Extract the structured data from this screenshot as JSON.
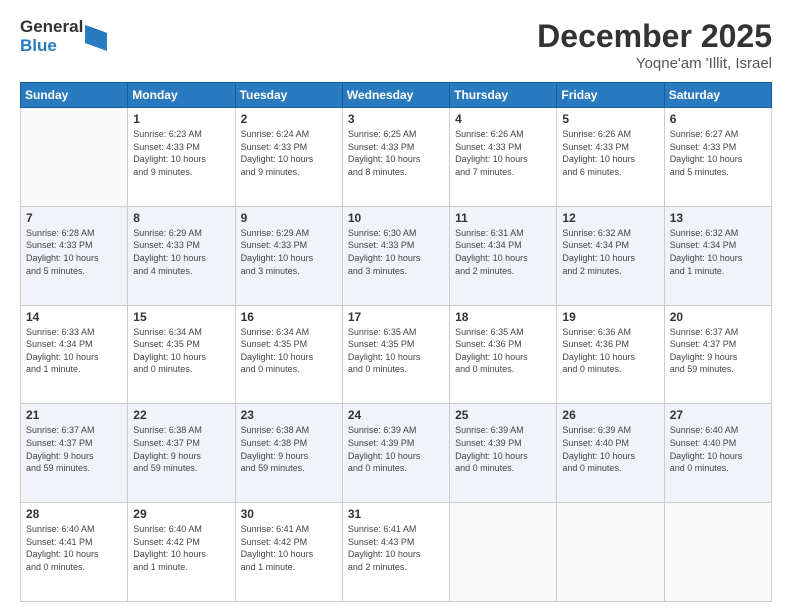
{
  "header": {
    "logo": {
      "general": "General",
      "blue": "Blue"
    },
    "title": "December 2025",
    "subtitle": "Yoqne'am 'Illit, Israel"
  },
  "calendar": {
    "days_of_week": [
      "Sunday",
      "Monday",
      "Tuesday",
      "Wednesday",
      "Thursday",
      "Friday",
      "Saturday"
    ],
    "weeks": [
      [
        {
          "day": "",
          "info": ""
        },
        {
          "day": "1",
          "info": "Sunrise: 6:23 AM\nSunset: 4:33 PM\nDaylight: 10 hours\nand 9 minutes."
        },
        {
          "day": "2",
          "info": "Sunrise: 6:24 AM\nSunset: 4:33 PM\nDaylight: 10 hours\nand 9 minutes."
        },
        {
          "day": "3",
          "info": "Sunrise: 6:25 AM\nSunset: 4:33 PM\nDaylight: 10 hours\nand 8 minutes."
        },
        {
          "day": "4",
          "info": "Sunrise: 6:26 AM\nSunset: 4:33 PM\nDaylight: 10 hours\nand 7 minutes."
        },
        {
          "day": "5",
          "info": "Sunrise: 6:26 AM\nSunset: 4:33 PM\nDaylight: 10 hours\nand 6 minutes."
        },
        {
          "day": "6",
          "info": "Sunrise: 6:27 AM\nSunset: 4:33 PM\nDaylight: 10 hours\nand 5 minutes."
        }
      ],
      [
        {
          "day": "7",
          "info": "Sunrise: 6:28 AM\nSunset: 4:33 PM\nDaylight: 10 hours\nand 5 minutes."
        },
        {
          "day": "8",
          "info": "Sunrise: 6:29 AM\nSunset: 4:33 PM\nDaylight: 10 hours\nand 4 minutes."
        },
        {
          "day": "9",
          "info": "Sunrise: 6:29 AM\nSunset: 4:33 PM\nDaylight: 10 hours\nand 3 minutes."
        },
        {
          "day": "10",
          "info": "Sunrise: 6:30 AM\nSunset: 4:33 PM\nDaylight: 10 hours\nand 3 minutes."
        },
        {
          "day": "11",
          "info": "Sunrise: 6:31 AM\nSunset: 4:34 PM\nDaylight: 10 hours\nand 2 minutes."
        },
        {
          "day": "12",
          "info": "Sunrise: 6:32 AM\nSunset: 4:34 PM\nDaylight: 10 hours\nand 2 minutes."
        },
        {
          "day": "13",
          "info": "Sunrise: 6:32 AM\nSunset: 4:34 PM\nDaylight: 10 hours\nand 1 minute."
        }
      ],
      [
        {
          "day": "14",
          "info": "Sunrise: 6:33 AM\nSunset: 4:34 PM\nDaylight: 10 hours\nand 1 minute."
        },
        {
          "day": "15",
          "info": "Sunrise: 6:34 AM\nSunset: 4:35 PM\nDaylight: 10 hours\nand 0 minutes."
        },
        {
          "day": "16",
          "info": "Sunrise: 6:34 AM\nSunset: 4:35 PM\nDaylight: 10 hours\nand 0 minutes."
        },
        {
          "day": "17",
          "info": "Sunrise: 6:35 AM\nSunset: 4:35 PM\nDaylight: 10 hours\nand 0 minutes."
        },
        {
          "day": "18",
          "info": "Sunrise: 6:35 AM\nSunset: 4:36 PM\nDaylight: 10 hours\nand 0 minutes."
        },
        {
          "day": "19",
          "info": "Sunrise: 6:36 AM\nSunset: 4:36 PM\nDaylight: 10 hours\nand 0 minutes."
        },
        {
          "day": "20",
          "info": "Sunrise: 6:37 AM\nSunset: 4:37 PM\nDaylight: 9 hours\nand 59 minutes."
        }
      ],
      [
        {
          "day": "21",
          "info": "Sunrise: 6:37 AM\nSunset: 4:37 PM\nDaylight: 9 hours\nand 59 minutes."
        },
        {
          "day": "22",
          "info": "Sunrise: 6:38 AM\nSunset: 4:37 PM\nDaylight: 9 hours\nand 59 minutes."
        },
        {
          "day": "23",
          "info": "Sunrise: 6:38 AM\nSunset: 4:38 PM\nDaylight: 9 hours\nand 59 minutes."
        },
        {
          "day": "24",
          "info": "Sunrise: 6:39 AM\nSunset: 4:39 PM\nDaylight: 10 hours\nand 0 minutes."
        },
        {
          "day": "25",
          "info": "Sunrise: 6:39 AM\nSunset: 4:39 PM\nDaylight: 10 hours\nand 0 minutes."
        },
        {
          "day": "26",
          "info": "Sunrise: 6:39 AM\nSunset: 4:40 PM\nDaylight: 10 hours\nand 0 minutes."
        },
        {
          "day": "27",
          "info": "Sunrise: 6:40 AM\nSunset: 4:40 PM\nDaylight: 10 hours\nand 0 minutes."
        }
      ],
      [
        {
          "day": "28",
          "info": "Sunrise: 6:40 AM\nSunset: 4:41 PM\nDaylight: 10 hours\nand 0 minutes."
        },
        {
          "day": "29",
          "info": "Sunrise: 6:40 AM\nSunset: 4:42 PM\nDaylight: 10 hours\nand 1 minute."
        },
        {
          "day": "30",
          "info": "Sunrise: 6:41 AM\nSunset: 4:42 PM\nDaylight: 10 hours\nand 1 minute."
        },
        {
          "day": "31",
          "info": "Sunrise: 6:41 AM\nSunset: 4:43 PM\nDaylight: 10 hours\nand 2 minutes."
        },
        {
          "day": "",
          "info": ""
        },
        {
          "day": "",
          "info": ""
        },
        {
          "day": "",
          "info": ""
        }
      ]
    ]
  }
}
